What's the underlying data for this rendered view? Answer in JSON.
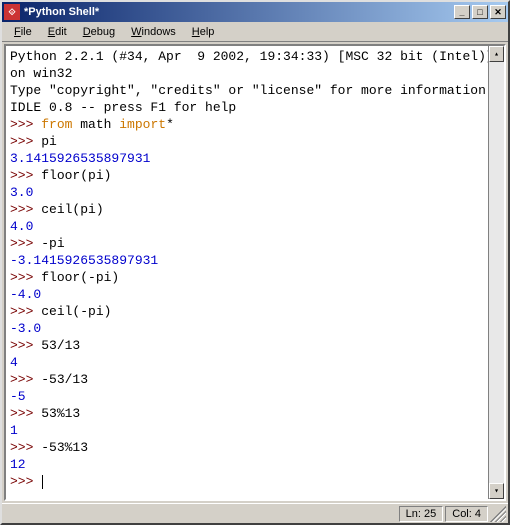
{
  "window": {
    "title": "*Python Shell*"
  },
  "menu": {
    "file": "File",
    "edit": "Edit",
    "debug": "Debug",
    "windows": "Windows",
    "help": "Help"
  },
  "banner": {
    "line1": "Python 2.2.1 (#34, Apr  9 2002, 19:34:33) [MSC 32 bit (Intel)] on win32",
    "line2": "Type \"copyright\", \"credits\" or \"license\" for more information.",
    "line3": "IDLE 0.8 -- press F1 for help"
  },
  "prompt": ">>> ",
  "lines": {
    "l1_kw1": "from",
    "l1_mod": " math ",
    "l1_kw2": "import",
    "l1_rest": "*",
    "l2_in": "pi",
    "l2_out": "3.1415926535897931",
    "l3_in": "floor(pi)",
    "l3_out": "3.0",
    "l4_in": "ceil(pi)",
    "l4_out": "4.0",
    "l5_in": "-pi",
    "l5_out": "-3.1415926535897931",
    "l6_in": "floor(-pi)",
    "l6_out": "-4.0",
    "l7_in": "ceil(-pi)",
    "l7_out": "-3.0",
    "l8_in": "53/13",
    "l8_out": "4",
    "l9_in": "-53/13",
    "l9_out": "-5",
    "l10_in": "53%13",
    "l10_out": "1",
    "l11_in": "-53%13",
    "l11_out": "12"
  },
  "status": {
    "ln": "Ln: 25",
    "col": "Col: 4"
  }
}
